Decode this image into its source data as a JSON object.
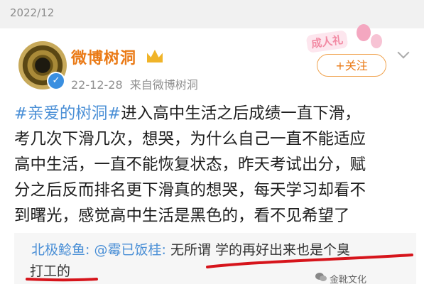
{
  "date_header": "2022/12",
  "post": {
    "author": "微博树洞",
    "date": "22-12-28",
    "source": "来自微博树洞",
    "follow_label": "+关注",
    "sticker_text": "成人礼",
    "body_lines": [
      "进入高中生活之后成绩一直下滑，",
      "考几次下滑几次，想哭，为什么自己一直不能适应",
      "高中生活，一直不能恢复状态，昨天考试出分，赋",
      "分之后反而排名更下滑真的想哭，每天学习却看不",
      "到曙光，感觉高中生活是黑色的，看不见希望了"
    ],
    "hashtag": "#亲爱的树洞#"
  },
  "comment": {
    "author": "北极鲶鱼",
    "reply_to": "@霉已饭桂",
    "text_line1": "无所谓 学的再好出来也是个臭",
    "text_line2": "打工的"
  },
  "watermark": "金靴文化",
  "colors": {
    "accent_orange": "#ea7a16",
    "link_blue": "#4a8fd6",
    "annotation_red": "#d6141b"
  },
  "icons": [
    "crown-icon",
    "verified-icon",
    "chevron-down-icon",
    "wechat-icon"
  ]
}
